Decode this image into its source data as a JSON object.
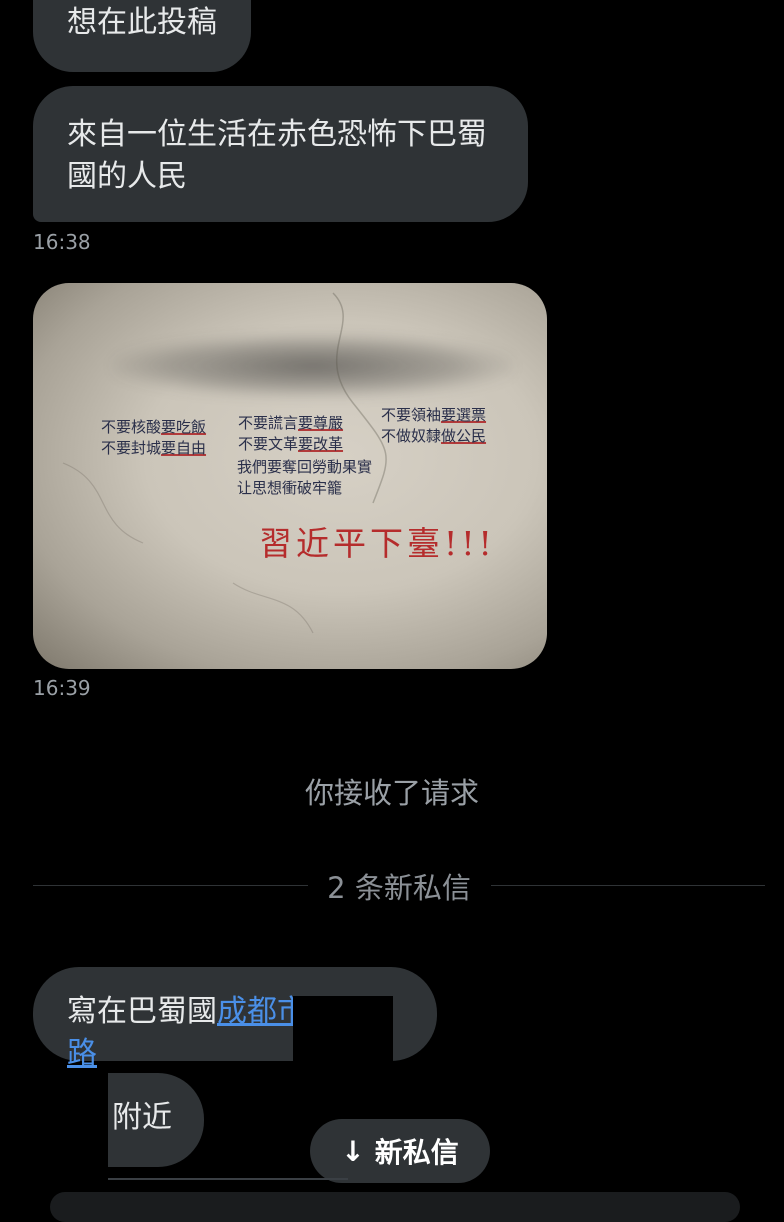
{
  "messages": [
    {
      "text": "想在此投稿"
    },
    {
      "text_line1": "來自一位生活在赤色恐怖下巴蜀",
      "text_line2": "國的人民",
      "time": "16:38"
    },
    {
      "type": "image",
      "time": "16:39"
    }
  ],
  "photo_text": {
    "col1_line1": "不要核酸",
    "col1_line1_ul": "要吃飯",
    "col1_line2": "不要封城",
    "col1_line2_ul": "要自由",
    "col2_line1": "不要謊言",
    "col2_line1_ul": "要尊嚴",
    "col2_line2": "不要文革",
    "col2_line2_ul": "要改革",
    "col3_line1": "不要領袖",
    "col3_line1_ul": "要選票",
    "col3_line2": "不做奴隸",
    "col3_line2_ul": "做公民",
    "mid_line1": "我們要奪回勞動果實",
    "mid_line2": "让思想衝破牢籠",
    "red_line": "習近平下臺!!!"
  },
  "notice": "你接收了请求",
  "divider_label": "2 条新私信",
  "message3": {
    "prefix": "寫在巴蜀國",
    "link": "成都市",
    "suffix": "路"
  },
  "message4": {
    "text": "附近"
  },
  "new_messages_button": {
    "arrow": "↓",
    "label": "新私信"
  }
}
